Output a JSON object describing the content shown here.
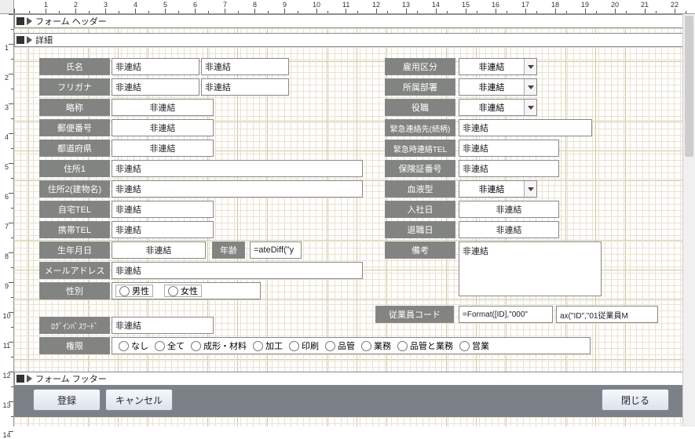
{
  "sections": {
    "header": "フォーム ヘッダー",
    "detail": "詳細",
    "footer": "フォーム フッター"
  },
  "labels": {
    "name": "氏名",
    "kana": "フリガナ",
    "abbr": "略称",
    "zip": "郵便番号",
    "pref": "都道府県",
    "addr1": "住所1",
    "addr2": "住所2(建物名)",
    "homeTel": "自宅TEL",
    "mobTel": "携帯TEL",
    "birth": "生年月日",
    "age": "年齢",
    "email": "メールアドレス",
    "sex": "性別",
    "loginPw": "ﾛｸﾞｲﾝﾊﾟｽﾜｰﾄﾞ",
    "auth": "権限",
    "employType": "雇用区分",
    "dept": "所属部署",
    "role": "役職",
    "emContact": "緊急連絡先(続柄)",
    "emTel": "緊急時連絡TEL",
    "insNo": "保険証番号",
    "blood": "血液型",
    "hireDate": "入社日",
    "leaveDate": "退職日",
    "note": "備考",
    "empCode": "従業員コード"
  },
  "unbound": "非連結",
  "ageExpr": "=ateDiff(\"y",
  "empCodeFmt": "=Format([ID],\"000\"",
  "empCodeMax": "ax(\"ID\",\"01従業員M",
  "sexOpts": {
    "m": "男性",
    "f": "女性"
  },
  "authOpts": [
    "なし",
    "全て",
    "成形・材料",
    "加工",
    "印刷",
    "品管",
    "業務",
    "品管と業務",
    "営業"
  ],
  "buttons": {
    "register": "登録",
    "cancel": "キャンセル",
    "close": "閉じる"
  }
}
